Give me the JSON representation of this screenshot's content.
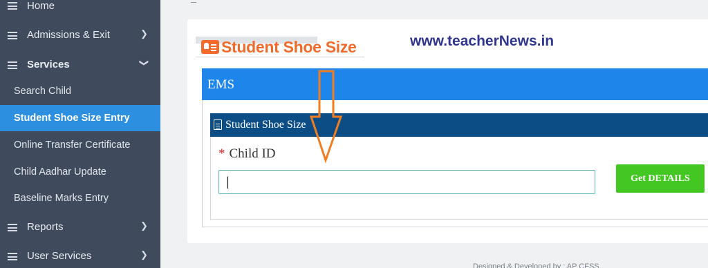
{
  "sidebar": {
    "items": [
      {
        "label": "Home",
        "has_arrow": false,
        "bold": false
      },
      {
        "label": "Admissions & Exit",
        "has_arrow": true,
        "bold": false
      },
      {
        "label": "Services",
        "has_arrow": true,
        "bold": true,
        "expanded": true
      },
      {
        "label": "Reports",
        "has_arrow": true,
        "bold": false
      },
      {
        "label": "User Services",
        "has_arrow": true,
        "bold": false
      }
    ],
    "subitems": [
      {
        "label": "Search Child",
        "active": false
      },
      {
        "label": "Student Shoe Size Entry",
        "active": true
      },
      {
        "label": "Online Transfer Certificate",
        "active": false
      },
      {
        "label": "Child Aadhar Update",
        "active": false
      },
      {
        "label": "Baseline Marks Entry",
        "active": false
      }
    ],
    "icons": {
      "menu": "hamburger-icon",
      "collapsed": "chevron-right-icon",
      "expanded": "chevron-down-icon"
    }
  },
  "page": {
    "title": "Student Shoe Size",
    "title_icon": "id-card-icon",
    "watermark": "www.teacherNews.in"
  },
  "panel": {
    "header": "EMS",
    "form_title": "Student Shoe Size",
    "form_icon": "document-icon",
    "field": {
      "required_mark": "*",
      "label": "Child ID",
      "value": "|"
    },
    "submit_label": "Get DETAILS"
  },
  "annotation": {
    "icon": "down-arrow-icon",
    "color": "#f07d22"
  },
  "footer": {
    "text": "Designed & Developed by : AP CFSS"
  },
  "colors": {
    "sidebar_bg": "#3f4b5c",
    "active_item": "#2d8fe0",
    "title_orange": "#ef6b2c",
    "watermark_blue": "#2f3690",
    "panel_header": "#1e86ea",
    "form_header": "#0d4d86",
    "button_green": "#43c823"
  }
}
